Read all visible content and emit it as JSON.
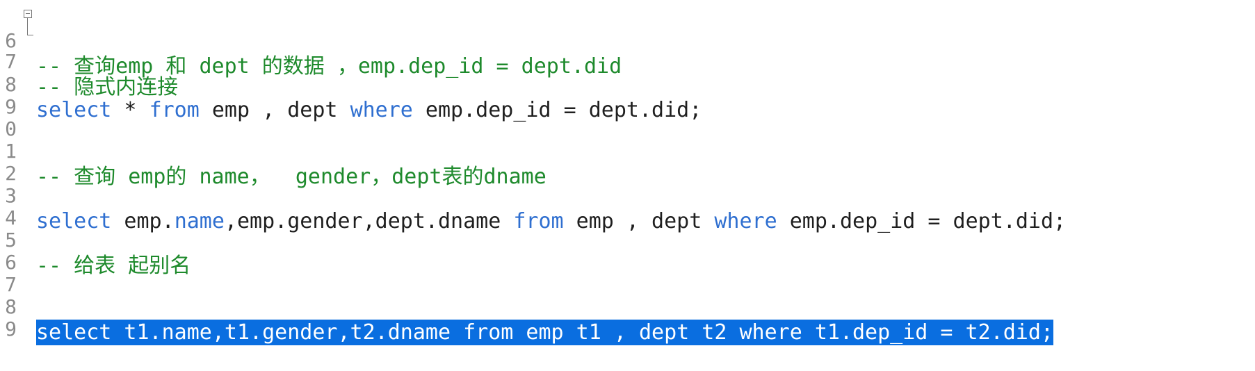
{
  "editor": {
    "lines": [
      {
        "num": "6",
        "text": "-- 查询emp 和 dept 的数据 ，emp.dep_id = dept.did"
      },
      {
        "num": "7",
        "text": "-- 隐式内连接"
      },
      {
        "num": "8",
        "kw1": "select",
        "p1": " * ",
        "kw2": "from",
        "p2": " emp , dept ",
        "kw3": "where",
        "p3": " emp.dep_id = dept.did;"
      },
      {
        "num": "9",
        "text": ""
      },
      {
        "num": "0",
        "text": ""
      },
      {
        "num": "1",
        "text": "-- 查询 emp的 name，  gender，dept表的dname"
      },
      {
        "num": "2",
        "text": ""
      },
      {
        "num": "3",
        "kw1": "select",
        "p1": " emp.",
        "kw2": "name",
        "p2": ",emp.gender,dept.dname ",
        "kw3": "from",
        "p3": " emp , dept ",
        "kw4": "where",
        "p4": " emp.dep_id = dept.did;"
      },
      {
        "num": "4",
        "text": ""
      },
      {
        "num": "5",
        "text": "-- 给表 起别名"
      },
      {
        "num": "6",
        "text": ""
      },
      {
        "num": "7",
        "text": ""
      },
      {
        "num": "8",
        "text": "select t1.name,t1.gender,t2.dname from emp t1 , dept t2 where t1.dep_id = t2.did;"
      },
      {
        "num": "9",
        "text": ""
      }
    ]
  },
  "colors": {
    "keyword": "#2f6fd0",
    "comment": "#1e8a2c",
    "selection": "#0a6ee0",
    "text": "#1f1f1f"
  }
}
